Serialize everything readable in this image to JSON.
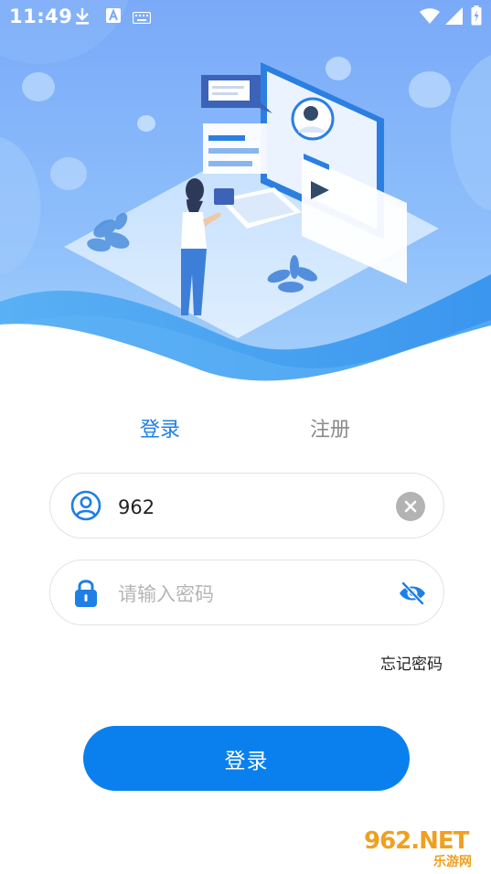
{
  "status_bar": {
    "time": "11:49",
    "left_icons": [
      "download-icon",
      "a-icon",
      "keyboard-icon"
    ],
    "right_icons": [
      "wifi-icon",
      "signal-icon",
      "battery-icon"
    ]
  },
  "tabs": {
    "login_label": "登录",
    "register_label": "注册",
    "active": "login"
  },
  "username_field": {
    "value": "962",
    "icon": "user-icon",
    "action_icon": "clear-icon"
  },
  "password_field": {
    "placeholder": "请输入密码",
    "value": "",
    "icon": "lock-icon",
    "action_icon": "eye-slash-icon"
  },
  "forgot_password_label": "忘记密码",
  "login_button_label": "登录",
  "watermark": {
    "main": "962.NET",
    "sub": "乐游网"
  },
  "colors": {
    "accent": "#0a80ee",
    "active_tab": "#1e7fe6",
    "inactive_tab": "#8a8a8a",
    "hero_top": "#7aa9f8",
    "hero_bottom": "#4aa3ef"
  }
}
